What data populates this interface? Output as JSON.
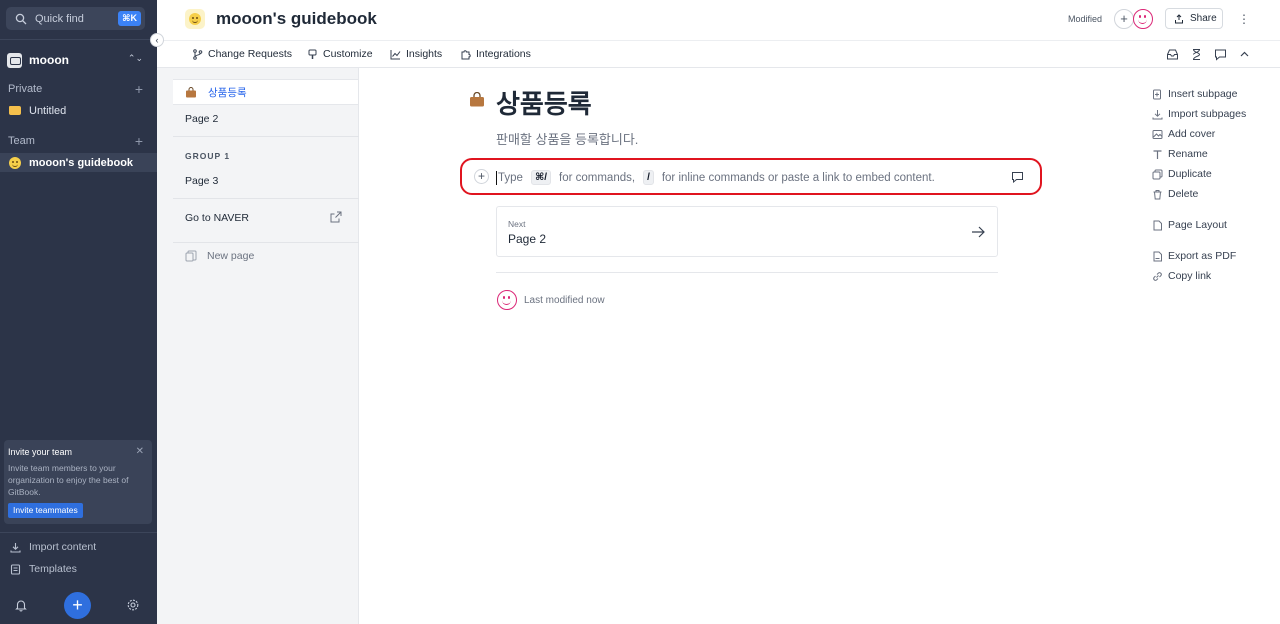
{
  "sidebar": {
    "quick_find": "Quick find",
    "quick_find_shortcut": "⌘K",
    "org_name": "mooon",
    "private_label": "Private",
    "private_items": [
      "Untitled"
    ],
    "team_label": "Team",
    "team_items": [
      "mooon's guidebook"
    ],
    "invite": {
      "title": "Invite your team",
      "text": "Invite team members to your organization to enjoy the best of GitBook.",
      "button": "Invite teammates"
    },
    "import_content": "Import content",
    "templates": "Templates",
    "fab_label": "+"
  },
  "header": {
    "space_title": "mooon's guidebook",
    "modified": "Modified",
    "share": "Share"
  },
  "subnav": {
    "items": [
      "Change Requests",
      "Customize",
      "Insights",
      "Integrations"
    ]
  },
  "pages": {
    "active": "상품등록",
    "page2": "Page 2",
    "group_label": "GROUP 1",
    "page3": "Page 3",
    "link": "Go to NAVER",
    "new_page": "New page"
  },
  "document": {
    "title": "상품등록",
    "description": "판매할 상품을 등록합니다.",
    "editor": {
      "type": "Type",
      "shortcut1": "⌘/",
      "for_commands": "for commands,",
      "shortcut2": "/",
      "rest": "for inline commands or paste a link to embed content."
    },
    "next_label": "Next",
    "next_title": "Page 2",
    "last_modified": "Last modified now"
  },
  "actions": [
    "Insert subpage",
    "Import subpages",
    "Add cover",
    "Rename",
    "Duplicate",
    "Delete",
    "Page Layout",
    "Export as PDF",
    "Copy link"
  ],
  "colors": {
    "sidebar_bg": "#2c3448",
    "accent": "#2f6fde",
    "highlight": "#e0141f",
    "avatar": "#db2777"
  }
}
